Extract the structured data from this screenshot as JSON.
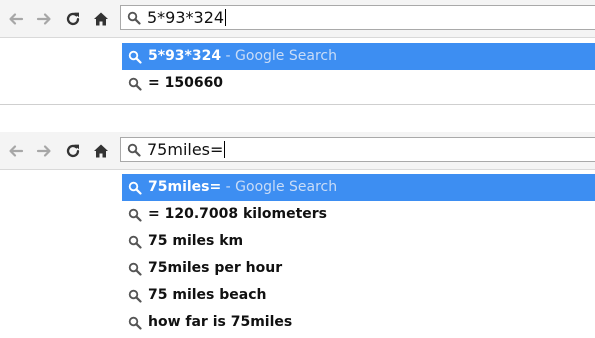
{
  "colors": {
    "toolbar_bg": "#f4f4f4",
    "selection_bg": "#3d8ef2",
    "hint_text": "#c9dcf7",
    "nav_disabled": "#9a9a9a",
    "nav_enabled": "#3a3a3a"
  },
  "nav_icons": {
    "back": "arrow-left",
    "forward": "arrow-right",
    "reload": "reload",
    "home": "home"
  },
  "panels": [
    {
      "omnibox_value": "5*93*324",
      "suggestions": [
        {
          "text": "5*93*324",
          "hint": " - Google Search",
          "selected": true
        },
        {
          "text": "= 150660",
          "hint": "",
          "selected": false
        }
      ]
    },
    {
      "omnibox_value": "75miles=",
      "suggestions": [
        {
          "text": "75miles=",
          "hint": " - Google Search",
          "selected": true
        },
        {
          "text": "= 120.7008 kilometers",
          "hint": "",
          "selected": false
        },
        {
          "text": "75 miles km",
          "hint": "",
          "selected": false
        },
        {
          "text": "75miles per hour",
          "hint": "",
          "selected": false
        },
        {
          "text": "75 miles beach",
          "hint": "",
          "selected": false
        },
        {
          "text": "how far is 75miles",
          "hint": "",
          "selected": false
        }
      ]
    }
  ]
}
